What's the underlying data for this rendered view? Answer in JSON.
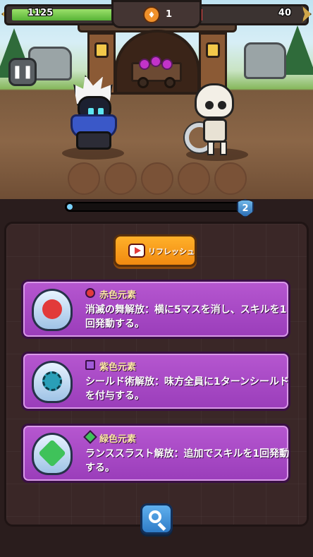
{
  "hud": {
    "player_hp": "1125",
    "enemy_hp": "40",
    "round": "1"
  },
  "progress": {
    "fill": 0.03,
    "level": "2"
  },
  "refresh": {
    "label": "リフレッシュ"
  },
  "cards": [
    {
      "element": "赤色元素",
      "description": "消滅の舞解放：横に5マスを消し、スキルを1回発動する。",
      "color": "#e23a3a",
      "icon": "dragon-icon"
    },
    {
      "element": "紫色元素",
      "description": "シールド術解放：味方全員に1ターンシールドを付与する。",
      "color": "#a05ad8",
      "icon": "shield-rune-icon"
    },
    {
      "element": "緑色元素",
      "description": "ランススラスト解放：追加でスキルを1回発動する。",
      "color": "#3fc25a",
      "icon": "lance-icon"
    }
  ],
  "colors": {
    "accent": "#b657d0",
    "highlight": "#7dff5a"
  }
}
